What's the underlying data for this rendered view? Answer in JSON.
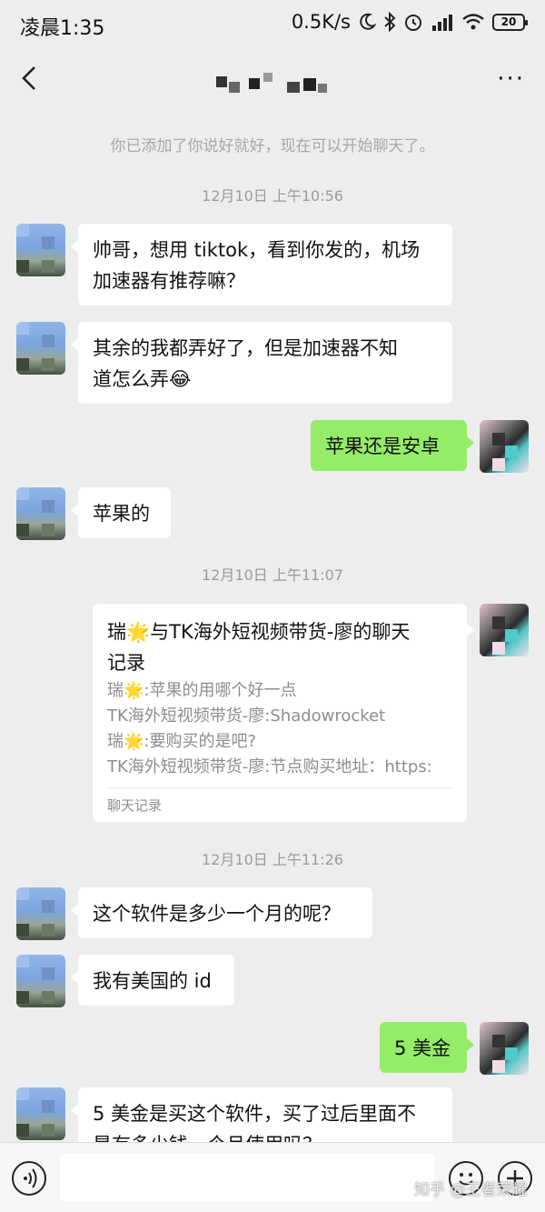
{
  "status_bar": {
    "time": "凌晨1:35",
    "network_speed": "0.5K/s",
    "battery": "20",
    "icons": [
      "moon-icon",
      "bluetooth-icon",
      "alarm-icon",
      "signal-icon",
      "wifi-icon",
      "battery-icon"
    ]
  },
  "navbar": {
    "back_icon": "chevron-left-icon",
    "title": "",
    "more_label": "···"
  },
  "chat": {
    "system_notice": "你已添加了你说好就好，现在可以开始聊天了。",
    "timestamps": [
      "12月10日 上午10:56",
      "12月10日 上午11:07",
      "12月10日 上午11:26"
    ],
    "messages": [
      {
        "side": "in",
        "line1": "帅哥，想用 tiktok，看到你发的，机场",
        "line2": "加速器有推荐嘛？"
      },
      {
        "side": "in",
        "line1": "其余的我都弄好了，但是加速器不知",
        "line2": "道怎么弄😂"
      },
      {
        "side": "out",
        "text": "苹果还是安卓"
      },
      {
        "side": "in",
        "text": "苹果的"
      },
      {
        "side": "in",
        "text": "这个软件是多少一个月的呢？"
      },
      {
        "side": "in",
        "text": "我有美国的 id"
      },
      {
        "side": "out",
        "text": "5 美金"
      },
      {
        "side": "in",
        "line1": "5 美金是买这个软件，买了过后里面不",
        "line2": "是有多少钱一个月使用吗？"
      }
    ],
    "forward_card": {
      "title_line1": "瑞🌟与TK海外短视频带货-廖的聊天",
      "title_line2": "记录",
      "lines": [
        "瑞🌟:苹果的用哪个好一点",
        "TK海外短视频带货-廖:Shadowrocket",
        "瑞🌟:要购买的是吧?",
        "TK海外短视频带货-廖:节点购买地址：https:"
      ],
      "footer": "聊天记录"
    }
  },
  "input_bar": {
    "placeholder": "",
    "icons": [
      "voice-icon",
      "emoji-icon",
      "plus-icon"
    ]
  },
  "watermark": "知乎 @王者荣耀"
}
